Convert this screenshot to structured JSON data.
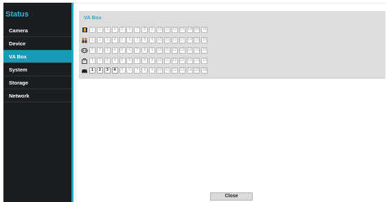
{
  "sidebar": {
    "title": "Status",
    "items": [
      {
        "label": "Camera"
      },
      {
        "label": "Device"
      },
      {
        "label": "VA Box",
        "active": true
      },
      {
        "label": "System"
      },
      {
        "label": "Storage"
      },
      {
        "label": "Network"
      }
    ]
  },
  "panel": {
    "title": "VA Box",
    "rows": [
      {
        "icon": "person-icon",
        "channels": [
          "1",
          "2",
          "3",
          "4",
          "5",
          "6",
          "7",
          "8",
          "9",
          "10",
          "11",
          "12",
          "13",
          "14",
          "15",
          "16"
        ],
        "active_count": 0
      },
      {
        "icon": "people-icon",
        "channels": [
          "1",
          "2",
          "3",
          "4",
          "5",
          "6",
          "7",
          "8",
          "9",
          "10",
          "11",
          "12",
          "13",
          "14",
          "15",
          "16"
        ],
        "active_count": 0
      },
      {
        "icon": "face-icon",
        "channels": [
          "1",
          "2",
          "3",
          "4",
          "5",
          "6",
          "7",
          "8",
          "9",
          "10",
          "11",
          "12",
          "13",
          "14",
          "15",
          "16"
        ],
        "active_count": 0
      },
      {
        "icon": "bag-icon",
        "channels": [
          "1",
          "2",
          "3",
          "4",
          "5",
          "6",
          "7",
          "8",
          "9",
          "10",
          "11",
          "12",
          "13",
          "14",
          "15",
          "16"
        ],
        "active_count": 0
      },
      {
        "icon": "car-icon",
        "channels": [
          "1",
          "2",
          "3",
          "4",
          "5",
          "6",
          "7",
          "8",
          "9",
          "10",
          "11",
          "12",
          "13",
          "14",
          "15",
          "16"
        ],
        "active_count": 4
      }
    ]
  },
  "footer": {
    "close_label": "Close"
  },
  "colors": {
    "accent": "#1ea9c5",
    "sidebar_bg": "#1b1d20",
    "active_item": "#159db8"
  }
}
